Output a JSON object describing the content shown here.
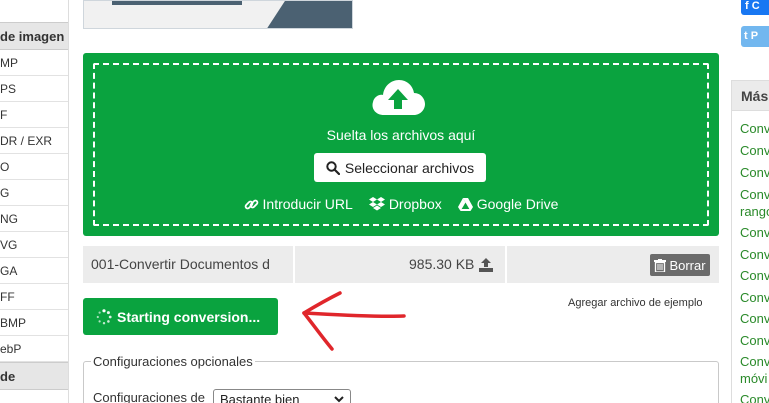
{
  "sidebar": {
    "header": "de imagen",
    "items": [
      "MP",
      "PS",
      "F",
      "DR / EXR",
      "O",
      "G",
      "NG",
      "VG",
      "GA",
      "FF",
      "BMP",
      "ebP"
    ],
    "footer": "de"
  },
  "dropzone": {
    "drop_text": "Suelta los archivos aquí",
    "select_label": "Seleccionar archivos",
    "url_label": "Introducir URL",
    "dropbox_label": "Dropbox",
    "gdrive_label": "Google Drive"
  },
  "file": {
    "name": "001-Convertir Documentos d",
    "size": "985.30 KB",
    "delete_label": "Borrar"
  },
  "sample_link": "Agregar archivo de ejemplo",
  "convert_label": "Starting conversion...",
  "options": {
    "legend": "Configuraciones opcionales",
    "label": "Configuraciones de",
    "select_value": "Bastante bien"
  },
  "right": {
    "fb_label": "C",
    "tw_label": "P",
    "header": "Más",
    "items": [
      "Conv",
      "Conv",
      "Conv",
      "Conv",
      "rango",
      "Conv",
      "Conv",
      "Conv",
      "Conv",
      "Conv",
      "Conv",
      "Conv",
      "móvi",
      "Conv"
    ]
  },
  "colors": {
    "green": "#0aa33f",
    "link_green": "#2a8a2a",
    "arrow_red": "#e0262b"
  }
}
